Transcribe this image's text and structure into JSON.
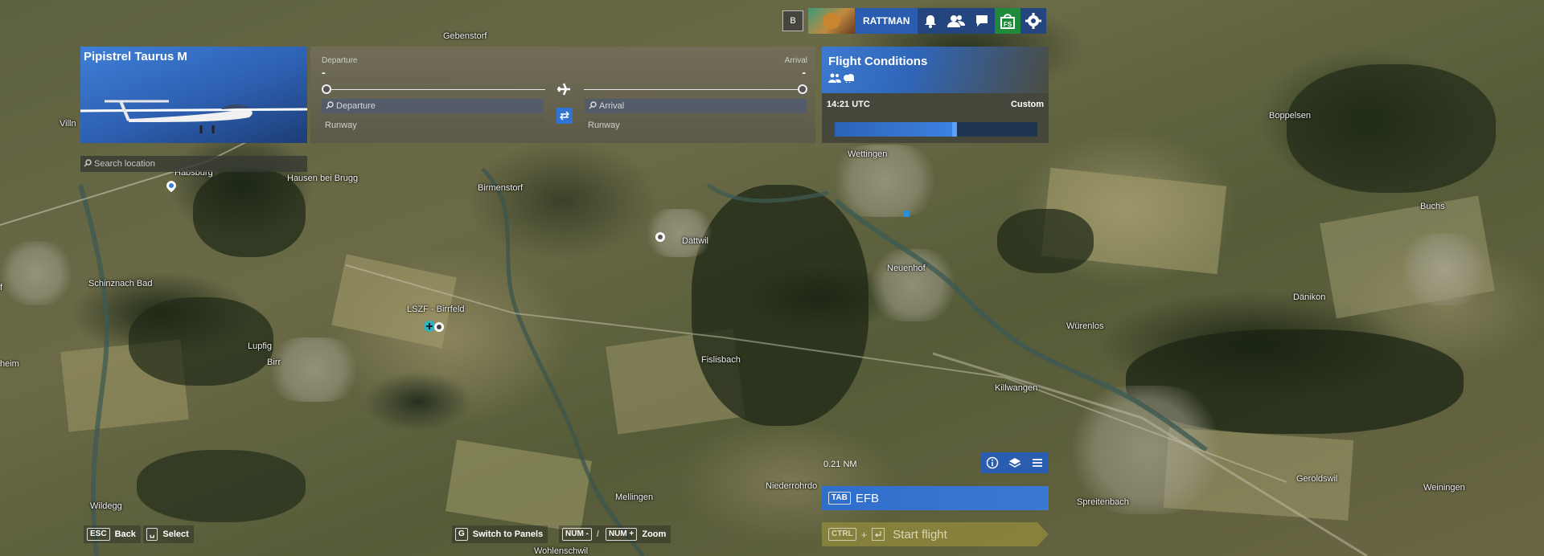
{
  "map": {
    "labels": [
      {
        "id": "gebenstorf",
        "text": "Gebenstorf"
      },
      {
        "id": "villnachern",
        "text": "Villn"
      },
      {
        "id": "habsburg",
        "text": "Habsburg"
      },
      {
        "id": "hausen",
        "text": "Hausen bei Brugg"
      },
      {
        "id": "birmenstorf",
        "text": "Birmenstorf"
      },
      {
        "id": "wettingen",
        "text": "Wettingen"
      },
      {
        "id": "boppelsen",
        "text": "Boppelsen"
      },
      {
        "id": "buchs",
        "text": "Buchs"
      },
      {
        "id": "dattwil",
        "text": "Dättwil"
      },
      {
        "id": "neuenhof",
        "text": "Neuenhof"
      },
      {
        "id": "schinznach",
        "text": "Schinznach Bad"
      },
      {
        "id": "dänikon",
        "text": "Dänikon"
      },
      {
        "id": "würenlos",
        "text": "Würenlos"
      },
      {
        "id": "lupfig",
        "text": "Lupfig"
      },
      {
        "id": "birr",
        "text": "Birr"
      },
      {
        "id": "fislisbach",
        "text": "Fislisbach"
      },
      {
        "id": "killwangen",
        "text": "Killwangen"
      },
      {
        "id": "heim",
        "text": "heim"
      },
      {
        "id": "f",
        "text": "f"
      },
      {
        "id": "geroldswil",
        "text": "Geroldswil"
      },
      {
        "id": "weiningen",
        "text": "Weiningen"
      },
      {
        "id": "niederrohrdorf",
        "text": "Niederrohrdo"
      },
      {
        "id": "mellingen",
        "text": "Mellingen"
      },
      {
        "id": "spreitenbach",
        "text": "Spreitenbach"
      },
      {
        "id": "wildegg",
        "text": "Wildegg"
      },
      {
        "id": "wohlenschwil",
        "text": "Wohlenschwil"
      }
    ],
    "airport_label": "LSZF - Birrfeld",
    "scale": "0.21 NM"
  },
  "aircraft": {
    "name": "Pipistrel Taurus M",
    "search_placeholder": "Search location"
  },
  "route": {
    "departure_label": "Departure",
    "arrival_label": "Arrival",
    "departure_value": "-",
    "arrival_value": "-",
    "departure_search": "Departure",
    "arrival_search": "Arrival",
    "departure_runway": "Runway",
    "arrival_runway": "Runway"
  },
  "conditions": {
    "title": "Flight Conditions",
    "time": "14:21 UTC",
    "weather": "Custom",
    "time_fraction": 0.59
  },
  "topbar": {
    "b_key": "B",
    "username": "RATTMAN"
  },
  "bottom": {
    "efb_key": "TAB",
    "efb_label": "EFB",
    "start_key": "CTRL",
    "start_plus": "+",
    "start_label": "Start flight",
    "hints": [
      {
        "key": "ESC",
        "label": "Back"
      },
      {
        "key": "␣",
        "label": "Select"
      },
      {
        "key": "G",
        "label": "Switch to Panels"
      },
      {
        "key": "NUM -",
        "label": ""
      },
      {
        "key": "NUM +",
        "label": "Zoom"
      }
    ]
  },
  "icons": {
    "bell": "bell-icon",
    "friends": "friends-icon",
    "chat": "chat-icon",
    "marketplace": "marketplace-icon",
    "settings": "gear-icon",
    "info": "info-icon",
    "layers": "layers-icon",
    "menu": "menu-icon",
    "plane": "plane-icon",
    "swap": "swap-icon"
  },
  "colors": {
    "accent": "#2f6fcc",
    "marketplace": "#1f8a3b",
    "start_flight": "#a0963c"
  }
}
